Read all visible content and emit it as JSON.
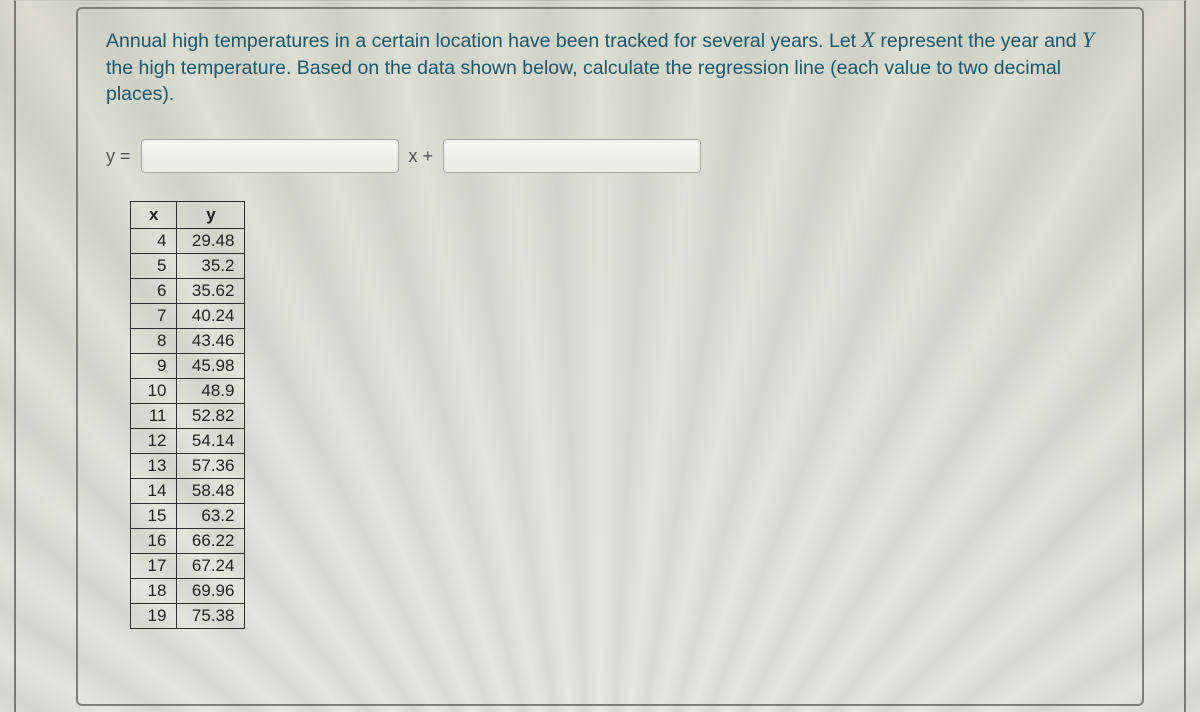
{
  "prompt": {
    "part1": "Annual high temperatures in a certain location have been tracked for several years. Let ",
    "varX": "X",
    "part2": " represent the year and ",
    "varY": "Y",
    "part3": " the high temperature. Based on the data shown below, calculate the regression line (each value to two decimal places)."
  },
  "equation": {
    "y_equals": "y =",
    "x_plus": "x +",
    "slope_value": "",
    "intercept_value": ""
  },
  "table": {
    "headers": {
      "x": "x",
      "y": "y"
    },
    "rows": [
      {
        "x": "4",
        "y": "29.48"
      },
      {
        "x": "5",
        "y": "35.2"
      },
      {
        "x": "6",
        "y": "35.62"
      },
      {
        "x": "7",
        "y": "40.24"
      },
      {
        "x": "8",
        "y": "43.46"
      },
      {
        "x": "9",
        "y": "45.98"
      },
      {
        "x": "10",
        "y": "48.9"
      },
      {
        "x": "11",
        "y": "52.82"
      },
      {
        "x": "12",
        "y": "54.14"
      },
      {
        "x": "13",
        "y": "57.36"
      },
      {
        "x": "14",
        "y": "58.48"
      },
      {
        "x": "15",
        "y": "63.2"
      },
      {
        "x": "16",
        "y": "66.22"
      },
      {
        "x": "17",
        "y": "67.24"
      },
      {
        "x": "18",
        "y": "69.96"
      },
      {
        "x": "19",
        "y": "75.38"
      }
    ]
  }
}
